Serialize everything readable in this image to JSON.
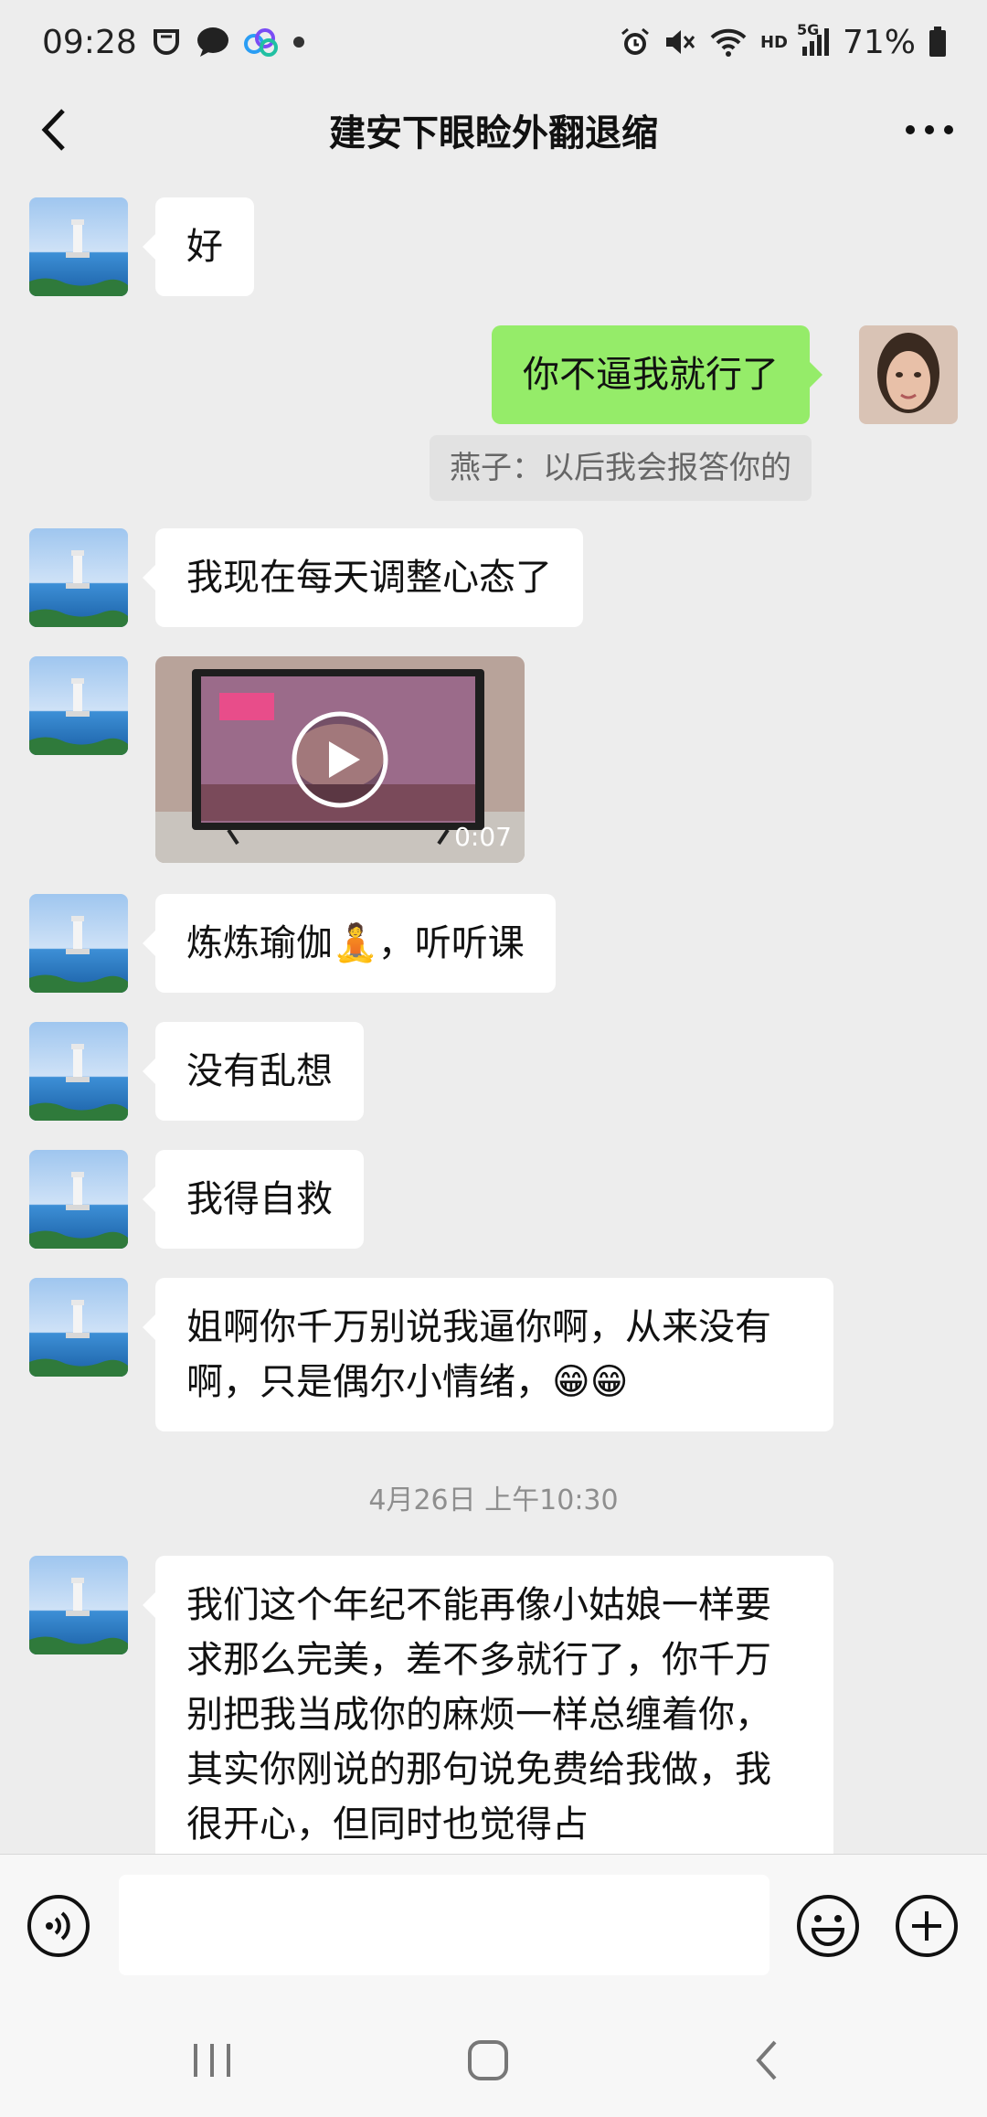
{
  "status_bar": {
    "time": "09:28",
    "network": "5G",
    "hd": "HD",
    "battery": "71%"
  },
  "header": {
    "title": "建安下眼睑外翻退缩"
  },
  "messages": [
    {
      "side": "in",
      "text": "好"
    },
    {
      "side": "out",
      "text": "你不逼我就行了"
    },
    {
      "quote": "燕子：以后我会报答你的"
    },
    {
      "side": "in",
      "text": "我现在每天调整心态了"
    },
    {
      "side": "in",
      "video_duration": "0:07"
    },
    {
      "side": "in",
      "text": "炼炼瑜伽🧘，听听课"
    },
    {
      "side": "in",
      "text": "没有乱想"
    },
    {
      "side": "in",
      "text": "我得自救"
    },
    {
      "side": "in",
      "text": "姐啊你千万别说我逼你啊，从来没有啊，只是偶尔小情绪，😁😁"
    },
    {
      "timestamp": "4月26日 上午10:30"
    },
    {
      "side": "in",
      "text": "我们这个年纪不能再像小姑娘一样要求那么完美，差不多就行了，你千万别把我当成你的麻烦一样总缠着你，其实你刚说的那句说免费给我做，我很开心，但同时也觉得占"
    }
  ],
  "input_bar": {
    "placeholder": ""
  },
  "colors": {
    "background": "#ededed",
    "incoming_bubble": "#ffffff",
    "outgoing_bubble": "#95ec69"
  },
  "icons": [
    "back-icon",
    "more-icon",
    "voice-icon",
    "emoji-icon",
    "plus-icon",
    "recents-icon",
    "home-icon",
    "nav-back-icon"
  ]
}
